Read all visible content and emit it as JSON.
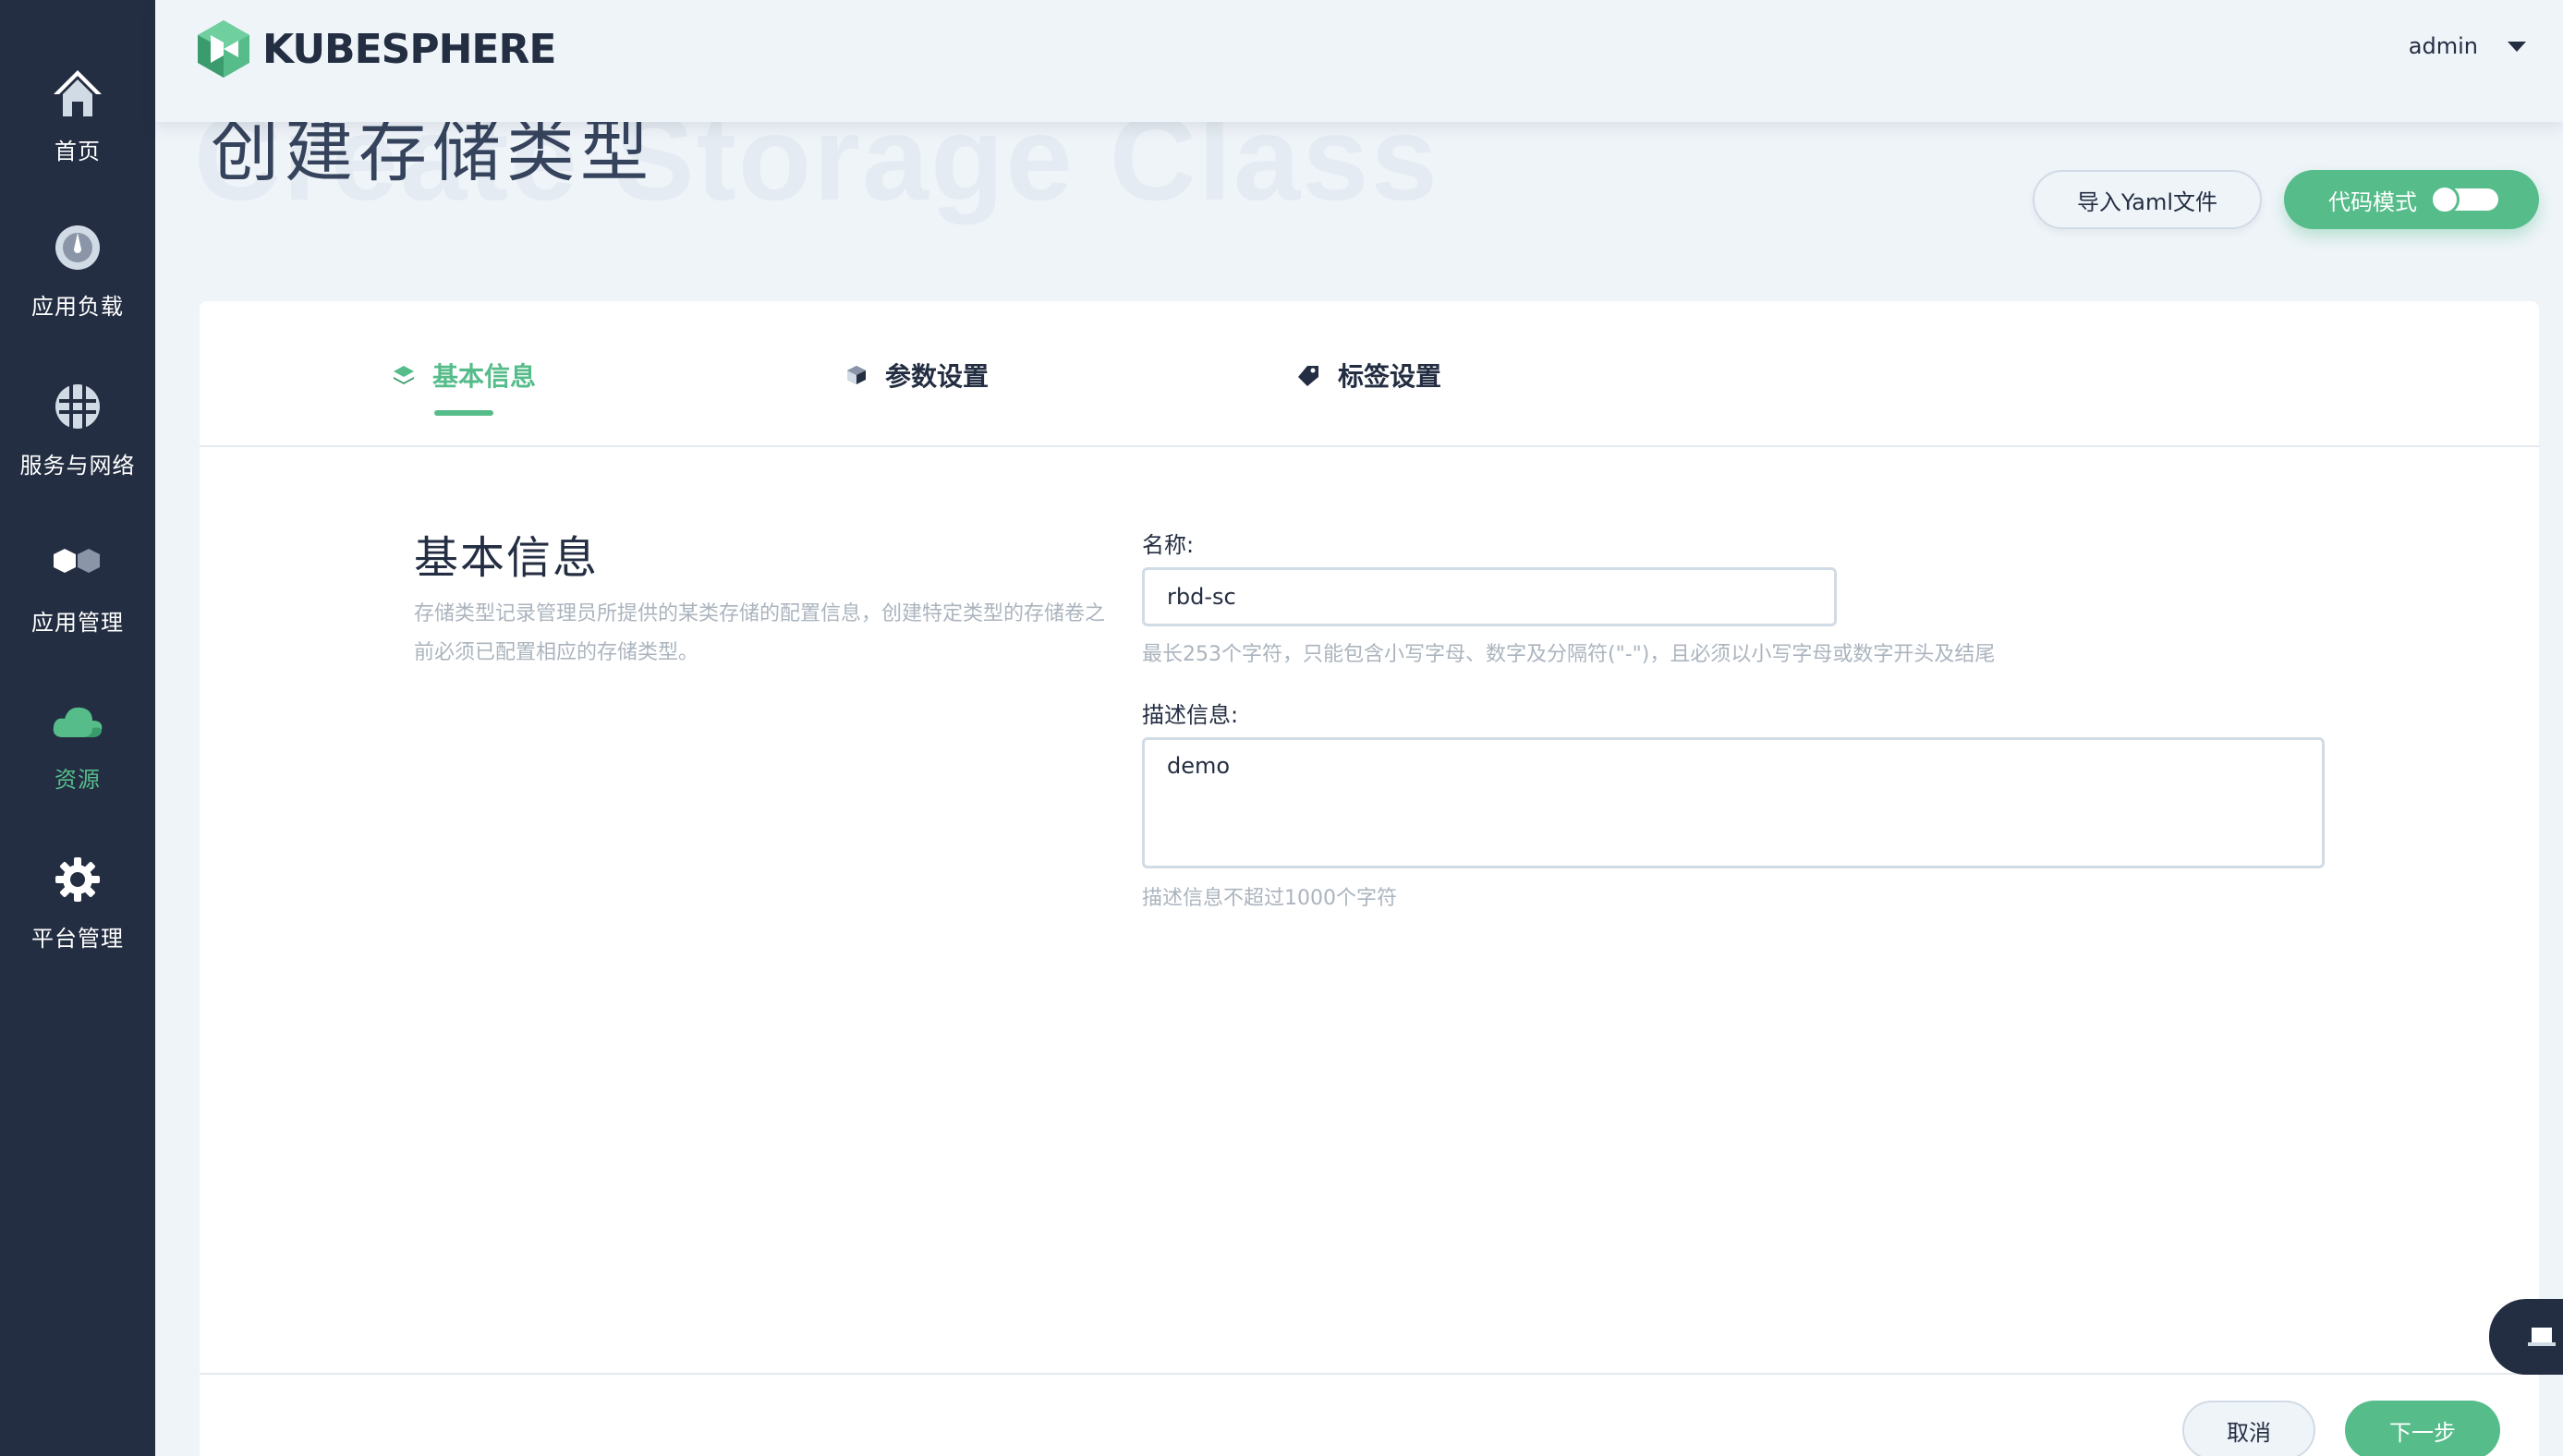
{
  "header": {
    "brand": "KUBESPHERE",
    "user": "admin"
  },
  "sidebar": {
    "items": [
      {
        "label": "首页",
        "icon": "home-icon"
      },
      {
        "label": "应用负载",
        "icon": "dashboard-icon"
      },
      {
        "label": "服务与网络",
        "icon": "network-icon"
      },
      {
        "label": "应用管理",
        "icon": "hexagons-icon"
      },
      {
        "label": "资源",
        "icon": "cloud-icon",
        "active": true
      },
      {
        "label": "平台管理",
        "icon": "gear-icon"
      }
    ]
  },
  "page": {
    "bg_title": "Create Storage Class",
    "title": "创建存储类型",
    "import_yaml": "导入Yaml文件",
    "code_mode": "代码模式"
  },
  "tabs": [
    {
      "label": "基本信息",
      "active": true
    },
    {
      "label": "参数设置"
    },
    {
      "label": "标签设置"
    }
  ],
  "form": {
    "section_title": "基本信息",
    "section_desc": "存储类型记录管理员所提供的某类存储的配置信息，创建特定类型的存储卷之前必须已配置相应的存储类型。",
    "name_label": "名称:",
    "name_value": "rbd-sc",
    "name_hint": "最长253个字符，只能包含小写字母、数字及分隔符(\"-\")，且必须以小写字母或数字开头及结尾",
    "desc_label": "描述信息:",
    "desc_value": "demo",
    "desc_hint": "描述信息不超过1000个字符"
  },
  "footer": {
    "cancel": "取消",
    "next": "下一步"
  },
  "colors": {
    "accent": "#55bc8a",
    "sidebar_bg": "#242e42",
    "page_bg": "#eff4f9"
  }
}
